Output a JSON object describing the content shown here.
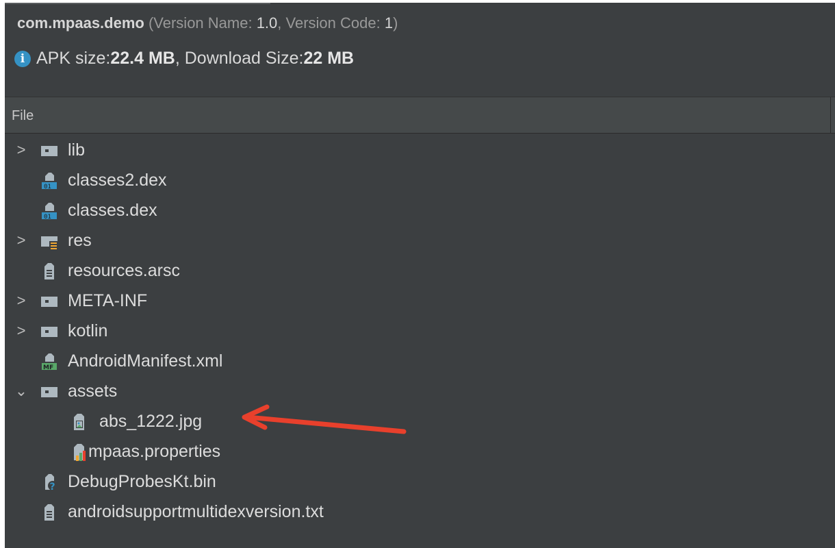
{
  "header": {
    "package": "com.mpaas.demo",
    "version_open": " (Version Name: ",
    "version_name": "1.0",
    "version_sep": ", Version Code: ",
    "version_code": "1",
    "version_close": ")",
    "apk_prefix": "APK size: ",
    "apk_size": "22.4 MB",
    "download_prefix": ", Download Size: ",
    "download_size": "22 MB"
  },
  "table": {
    "column": "File"
  },
  "tree": [
    {
      "label": "lib",
      "icon": "folder-icon",
      "chevron": ">"
    },
    {
      "label": "classes2.dex",
      "icon": "dex-file-icon"
    },
    {
      "label": "classes.dex",
      "icon": "dex-file-icon"
    },
    {
      "label": "res",
      "icon": "resource-folder-icon",
      "chevron": ">"
    },
    {
      "label": "resources.arsc",
      "icon": "text-file-icon"
    },
    {
      "label": "META-INF",
      "icon": "folder-icon",
      "chevron": ">"
    },
    {
      "label": "kotlin",
      "icon": "folder-icon",
      "chevron": ">"
    },
    {
      "label": "AndroidManifest.xml",
      "icon": "manifest-file-icon"
    },
    {
      "label": "assets",
      "icon": "folder-icon",
      "chevron": "⌄"
    },
    {
      "label": "abs_1222.jpg",
      "icon": "image-file-icon"
    },
    {
      "label": "mpaas.properties",
      "icon": "properties-file-icon"
    },
    {
      "label": "DebugProbesKt.bin",
      "icon": "unknown-file-icon"
    },
    {
      "label": "androidsupportmultidexversion.txt",
      "icon": "text-file-icon"
    }
  ],
  "annotation": {
    "color": "#e8402c",
    "target": "abs_1222.jpg",
    "icon": "red-arrow-icon"
  }
}
